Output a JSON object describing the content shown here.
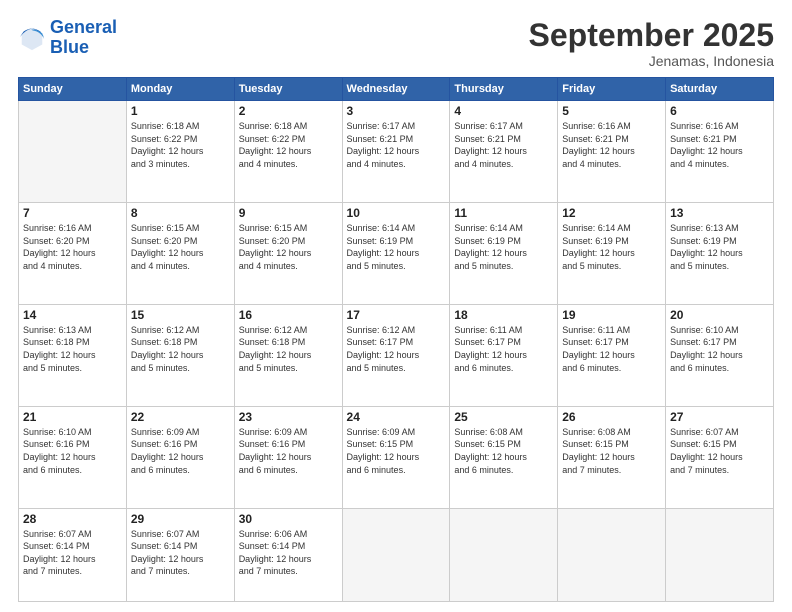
{
  "logo": {
    "line1": "General",
    "line2": "Blue"
  },
  "title": "September 2025",
  "location": "Jenamas, Indonesia",
  "days_header": [
    "Sunday",
    "Monday",
    "Tuesday",
    "Wednesday",
    "Thursday",
    "Friday",
    "Saturday"
  ],
  "weeks": [
    [
      {
        "day": "",
        "info": ""
      },
      {
        "day": "1",
        "info": "Sunrise: 6:18 AM\nSunset: 6:22 PM\nDaylight: 12 hours\nand 3 minutes."
      },
      {
        "day": "2",
        "info": "Sunrise: 6:18 AM\nSunset: 6:22 PM\nDaylight: 12 hours\nand 4 minutes."
      },
      {
        "day": "3",
        "info": "Sunrise: 6:17 AM\nSunset: 6:21 PM\nDaylight: 12 hours\nand 4 minutes."
      },
      {
        "day": "4",
        "info": "Sunrise: 6:17 AM\nSunset: 6:21 PM\nDaylight: 12 hours\nand 4 minutes."
      },
      {
        "day": "5",
        "info": "Sunrise: 6:16 AM\nSunset: 6:21 PM\nDaylight: 12 hours\nand 4 minutes."
      },
      {
        "day": "6",
        "info": "Sunrise: 6:16 AM\nSunset: 6:21 PM\nDaylight: 12 hours\nand 4 minutes."
      }
    ],
    [
      {
        "day": "7",
        "info": "Sunrise: 6:16 AM\nSunset: 6:20 PM\nDaylight: 12 hours\nand 4 minutes."
      },
      {
        "day": "8",
        "info": "Sunrise: 6:15 AM\nSunset: 6:20 PM\nDaylight: 12 hours\nand 4 minutes."
      },
      {
        "day": "9",
        "info": "Sunrise: 6:15 AM\nSunset: 6:20 PM\nDaylight: 12 hours\nand 4 minutes."
      },
      {
        "day": "10",
        "info": "Sunrise: 6:14 AM\nSunset: 6:19 PM\nDaylight: 12 hours\nand 5 minutes."
      },
      {
        "day": "11",
        "info": "Sunrise: 6:14 AM\nSunset: 6:19 PM\nDaylight: 12 hours\nand 5 minutes."
      },
      {
        "day": "12",
        "info": "Sunrise: 6:14 AM\nSunset: 6:19 PM\nDaylight: 12 hours\nand 5 minutes."
      },
      {
        "day": "13",
        "info": "Sunrise: 6:13 AM\nSunset: 6:19 PM\nDaylight: 12 hours\nand 5 minutes."
      }
    ],
    [
      {
        "day": "14",
        "info": "Sunrise: 6:13 AM\nSunset: 6:18 PM\nDaylight: 12 hours\nand 5 minutes."
      },
      {
        "day": "15",
        "info": "Sunrise: 6:12 AM\nSunset: 6:18 PM\nDaylight: 12 hours\nand 5 minutes."
      },
      {
        "day": "16",
        "info": "Sunrise: 6:12 AM\nSunset: 6:18 PM\nDaylight: 12 hours\nand 5 minutes."
      },
      {
        "day": "17",
        "info": "Sunrise: 6:12 AM\nSunset: 6:17 PM\nDaylight: 12 hours\nand 5 minutes."
      },
      {
        "day": "18",
        "info": "Sunrise: 6:11 AM\nSunset: 6:17 PM\nDaylight: 12 hours\nand 6 minutes."
      },
      {
        "day": "19",
        "info": "Sunrise: 6:11 AM\nSunset: 6:17 PM\nDaylight: 12 hours\nand 6 minutes."
      },
      {
        "day": "20",
        "info": "Sunrise: 6:10 AM\nSunset: 6:17 PM\nDaylight: 12 hours\nand 6 minutes."
      }
    ],
    [
      {
        "day": "21",
        "info": "Sunrise: 6:10 AM\nSunset: 6:16 PM\nDaylight: 12 hours\nand 6 minutes."
      },
      {
        "day": "22",
        "info": "Sunrise: 6:09 AM\nSunset: 6:16 PM\nDaylight: 12 hours\nand 6 minutes."
      },
      {
        "day": "23",
        "info": "Sunrise: 6:09 AM\nSunset: 6:16 PM\nDaylight: 12 hours\nand 6 minutes."
      },
      {
        "day": "24",
        "info": "Sunrise: 6:09 AM\nSunset: 6:15 PM\nDaylight: 12 hours\nand 6 minutes."
      },
      {
        "day": "25",
        "info": "Sunrise: 6:08 AM\nSunset: 6:15 PM\nDaylight: 12 hours\nand 6 minutes."
      },
      {
        "day": "26",
        "info": "Sunrise: 6:08 AM\nSunset: 6:15 PM\nDaylight: 12 hours\nand 7 minutes."
      },
      {
        "day": "27",
        "info": "Sunrise: 6:07 AM\nSunset: 6:15 PM\nDaylight: 12 hours\nand 7 minutes."
      }
    ],
    [
      {
        "day": "28",
        "info": "Sunrise: 6:07 AM\nSunset: 6:14 PM\nDaylight: 12 hours\nand 7 minutes."
      },
      {
        "day": "29",
        "info": "Sunrise: 6:07 AM\nSunset: 6:14 PM\nDaylight: 12 hours\nand 7 minutes."
      },
      {
        "day": "30",
        "info": "Sunrise: 6:06 AM\nSunset: 6:14 PM\nDaylight: 12 hours\nand 7 minutes."
      },
      {
        "day": "",
        "info": ""
      },
      {
        "day": "",
        "info": ""
      },
      {
        "day": "",
        "info": ""
      },
      {
        "day": "",
        "info": ""
      }
    ]
  ]
}
